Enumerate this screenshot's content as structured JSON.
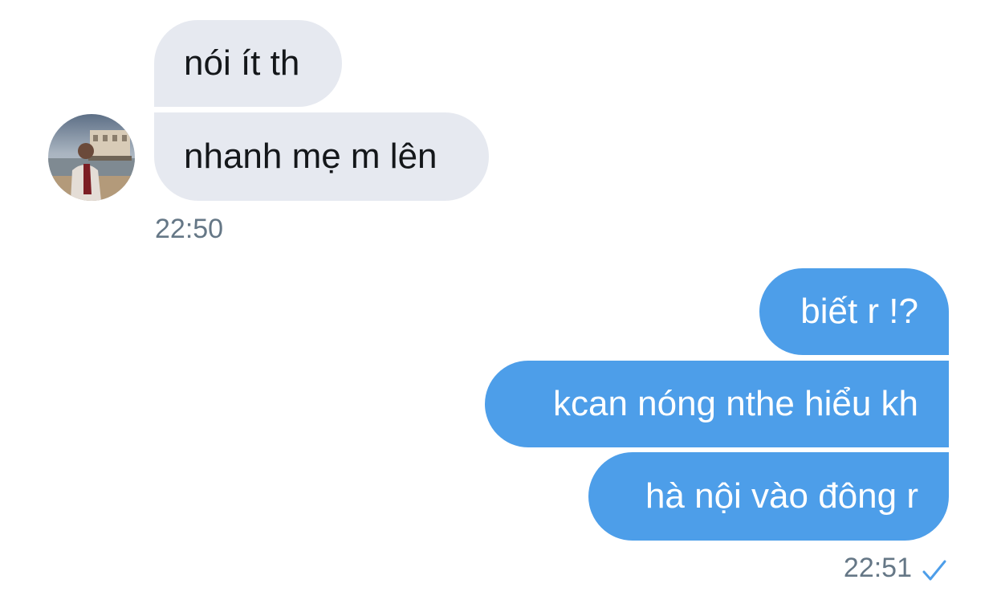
{
  "conversation": {
    "contact": {
      "avatar_icon": "user-avatar-photo",
      "messages": [
        "nói ít th",
        "nhanh mẹ m lên"
      ],
      "timestamp": "22:50"
    },
    "self": {
      "messages": [
        "biết r !?",
        "kcan nóng nthe hiểu kh",
        "hà nội vào đông r"
      ],
      "timestamp": "22:51",
      "status_icon": "checkmark-icon"
    },
    "colors": {
      "incoming_bubble": "#e6e9f0",
      "outgoing_bubble": "#4d9ee9",
      "timestamp_text": "#657786"
    }
  }
}
